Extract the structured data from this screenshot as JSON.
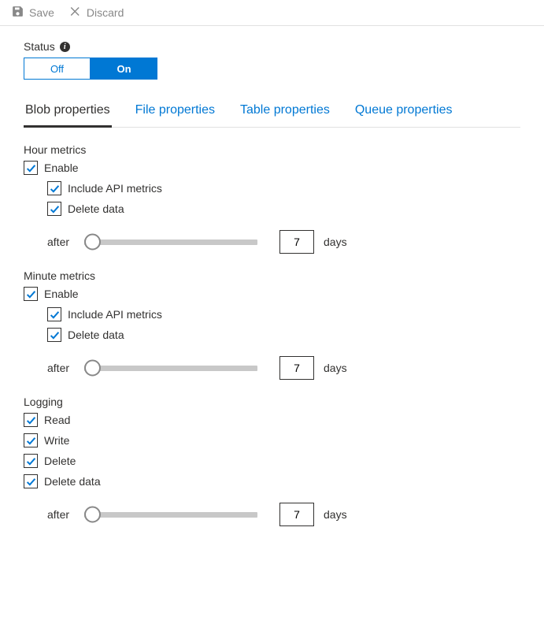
{
  "toolbar": {
    "save_label": "Save",
    "discard_label": "Discard"
  },
  "status": {
    "label": "Status",
    "off_label": "Off",
    "on_label": "On"
  },
  "tabs": [
    {
      "label": "Blob properties"
    },
    {
      "label": "File properties"
    },
    {
      "label": "Table properties"
    },
    {
      "label": "Queue properties"
    }
  ],
  "sections": {
    "hour": {
      "title": "Hour metrics",
      "enable_label": "Enable",
      "include_api_label": "Include API metrics",
      "delete_data_label": "Delete data",
      "after_label": "after",
      "days_value": "7",
      "days_label": "days"
    },
    "minute": {
      "title": "Minute metrics",
      "enable_label": "Enable",
      "include_api_label": "Include API metrics",
      "delete_data_label": "Delete data",
      "after_label": "after",
      "days_value": "7",
      "days_label": "days"
    },
    "logging": {
      "title": "Logging",
      "read_label": "Read",
      "write_label": "Write",
      "delete_label": "Delete",
      "delete_data_label": "Delete data",
      "after_label": "after",
      "days_value": "7",
      "days_label": "days"
    }
  }
}
